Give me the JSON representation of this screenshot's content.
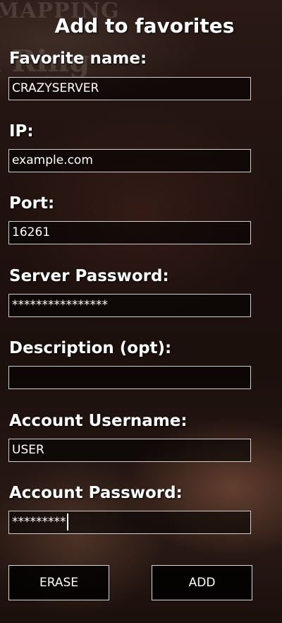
{
  "background": {
    "deco_line_1": "MAPPING",
    "deco_line_2": "l Ring"
  },
  "dialog": {
    "title": "Add to favorites"
  },
  "fields": {
    "favorite_name": {
      "label": "Favorite name:",
      "value": "CRAZYSERVER"
    },
    "ip": {
      "label": "IP:",
      "value": "example.com"
    },
    "port": {
      "label": "Port:",
      "value": "16261"
    },
    "server_password": {
      "label": "Server Password:",
      "value": "****************"
    },
    "description": {
      "label": "Description (opt):",
      "value": ""
    },
    "account_username": {
      "label": "Account Username:",
      "value": "USER"
    },
    "account_password": {
      "label": "Account Password:",
      "value": "*********"
    }
  },
  "buttons": {
    "erase": "ERASE",
    "add": "ADD"
  }
}
